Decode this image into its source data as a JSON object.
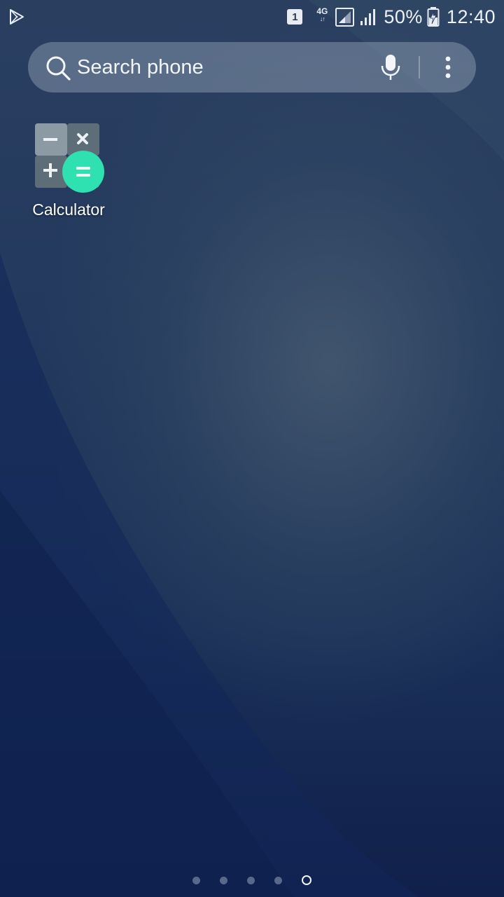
{
  "status_bar": {
    "notification_icon": "play-store-icon",
    "sim_slot": "1",
    "network_type": "4G",
    "network_activity": "↓↑",
    "battery_percent": "50%",
    "time": "12:40"
  },
  "search": {
    "placeholder": "Search phone",
    "icons": [
      "search-icon",
      "mic-icon",
      "more-vert-icon"
    ]
  },
  "apps": [
    {
      "label": "Calculator",
      "icon": "calculator-icon"
    }
  ],
  "page_indicator": {
    "count": 5,
    "active_index": 4
  },
  "colors": {
    "calculator_accent": "#2fe0b0",
    "calculator_tile_dark": "#5e6e79",
    "calculator_tile_light": "#8c9aa4"
  }
}
